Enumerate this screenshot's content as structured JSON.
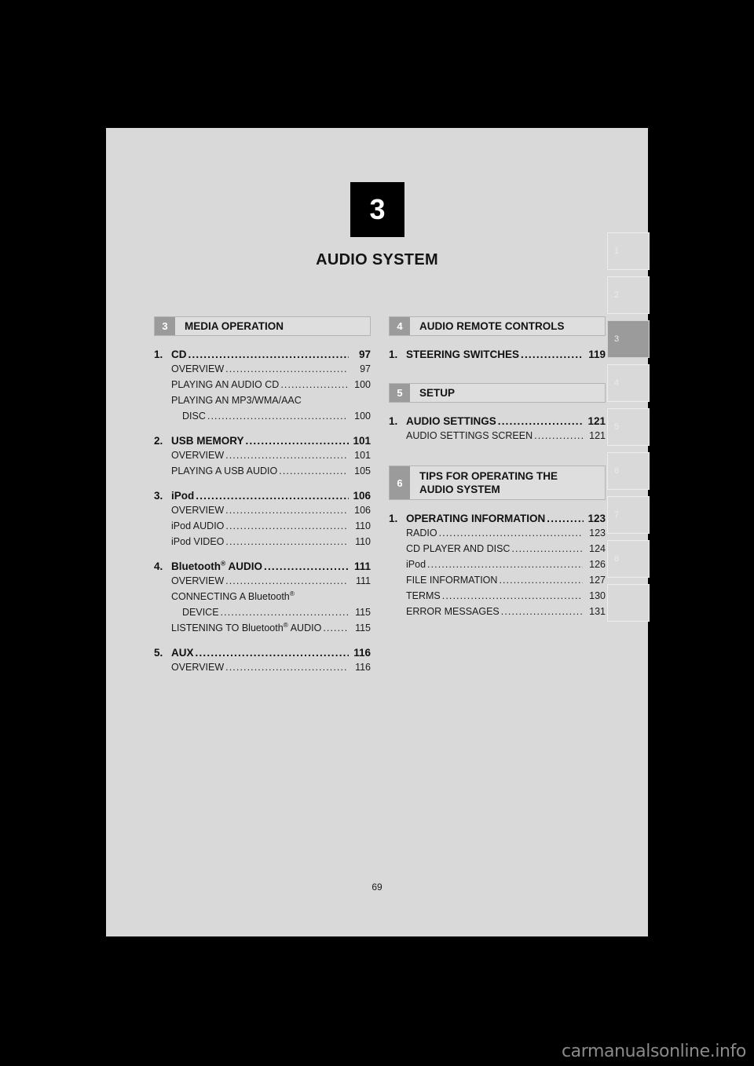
{
  "page": {
    "number": "69",
    "chapter_number": "3",
    "chapter_title": "AUDIO SYSTEM",
    "background_color": "#d9d9d9",
    "badge_color": "#000000"
  },
  "watermark": {
    "text": "carmanualsonline.info"
  },
  "tab_strip": {
    "active_index": 2,
    "tabs": [
      {
        "label": "1"
      },
      {
        "label": "2"
      },
      {
        "label": "3"
      },
      {
        "label": "4"
      },
      {
        "label": "5"
      },
      {
        "label": "6"
      },
      {
        "label": "7"
      },
      {
        "label": "8"
      },
      {
        "label": ""
      }
    ]
  },
  "columns": {
    "left": [
      {
        "section_number": "3",
        "section_title": "MEDIA OPERATION",
        "entries": [
          {
            "index": "1.",
            "title": "CD",
            "page": "97",
            "subentries": [
              {
                "title": "OVERVIEW",
                "page": "97"
              },
              {
                "title": "PLAYING AN AUDIO CD",
                "page": "100"
              },
              {
                "title": "PLAYING AN MP3/WMA/AAC",
                "page": "",
                "wrap": true
              },
              {
                "title": "DISC",
                "page": "100",
                "continuation": true
              }
            ]
          },
          {
            "index": "2.",
            "title": "USB MEMORY",
            "page": "101",
            "subentries": [
              {
                "title": "OVERVIEW",
                "page": "101"
              },
              {
                "title": "PLAYING A USB AUDIO",
                "page": "105"
              }
            ]
          },
          {
            "index": "3.",
            "title": "iPod",
            "page": "106",
            "subentries": [
              {
                "title": "OVERVIEW",
                "page": "106"
              },
              {
                "title": "iPod AUDIO",
                "page": "110"
              },
              {
                "title": "iPod VIDEO",
                "page": "110"
              }
            ]
          },
          {
            "index": "4.",
            "title": "Bluetooth® AUDIO",
            "title_html": "Bluetooth<sup>®</sup> AUDIO",
            "page": "111",
            "subentries": [
              {
                "title": "OVERVIEW",
                "page": "111"
              },
              {
                "title": "CONNECTING A Bluetooth®",
                "title_html": "CONNECTING A Bluetooth<sup>®</sup>",
                "page": "",
                "wrap": true
              },
              {
                "title": "DEVICE",
                "page": "115",
                "continuation": true
              },
              {
                "title": "LISTENING TO Bluetooth® AUDIO",
                "title_html": "LISTENING TO Bluetooth<sup>®</sup> AUDIO",
                "page": "115"
              }
            ]
          },
          {
            "index": "5.",
            "title": "AUX",
            "page": "116",
            "subentries": [
              {
                "title": "OVERVIEW",
                "page": "116"
              }
            ]
          }
        ]
      }
    ],
    "right": [
      {
        "section_number": "4",
        "section_title": "AUDIO REMOTE CONTROLS",
        "entries": [
          {
            "index": "1.",
            "title": "STEERING SWITCHES",
            "page": "119",
            "subentries": []
          }
        ]
      },
      {
        "section_number": "5",
        "section_title": "SETUP",
        "entries": [
          {
            "index": "1.",
            "title": "AUDIO SETTINGS",
            "page": "121",
            "subentries": [
              {
                "title": "AUDIO SETTINGS SCREEN",
                "page": "121"
              }
            ]
          }
        ]
      },
      {
        "section_number": "6",
        "section_title": "TIPS FOR OPERATING THE AUDIO SYSTEM",
        "section_title_line1": "TIPS FOR OPERATING THE",
        "section_title_line2": "AUDIO SYSTEM",
        "two_line": true,
        "entries": [
          {
            "index": "1.",
            "title": "OPERATING INFORMATION",
            "page": "123",
            "subentries": [
              {
                "title": "RADIO",
                "page": "123"
              },
              {
                "title": "CD PLAYER AND DISC",
                "page": "124"
              },
              {
                "title": "iPod",
                "page": "126"
              },
              {
                "title": "FILE INFORMATION",
                "page": "127"
              },
              {
                "title": "TERMS",
                "page": "130"
              },
              {
                "title": "ERROR MESSAGES",
                "page": "131"
              }
            ]
          }
        ]
      }
    ]
  }
}
